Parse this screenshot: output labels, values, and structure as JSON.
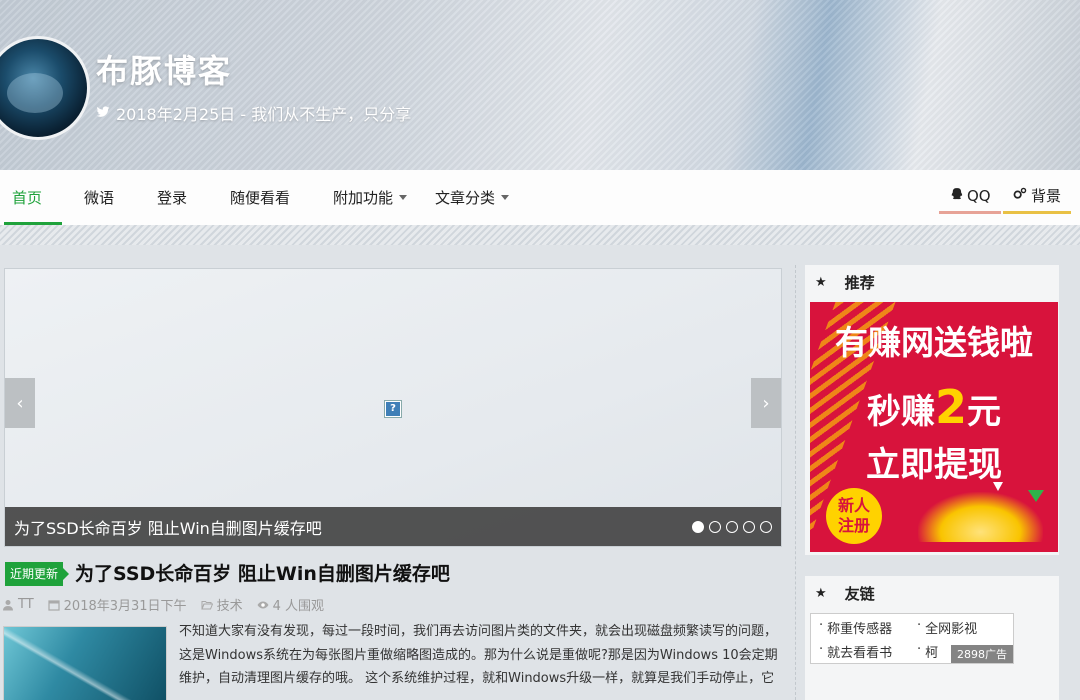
{
  "header": {
    "site_title": "布豚博客",
    "tagline": "2018年2月25日 - 我们从不生产，只分享",
    "tagline_icon": "twitter-icon"
  },
  "nav": {
    "items": [
      {
        "label": "首页",
        "active": true
      },
      {
        "label": "微语"
      },
      {
        "label": "登录"
      },
      {
        "label": "随便看看"
      },
      {
        "label": "附加功能",
        "dropdown": true
      },
      {
        "label": "文章分类",
        "dropdown": true
      }
    ],
    "right": [
      {
        "label": "QQ",
        "icon": "qq-icon",
        "underline": "#e7a397"
      },
      {
        "label": "背景",
        "icon": "gears-icon",
        "underline": "#e9c145"
      }
    ],
    "active_color": "#1fa23b"
  },
  "slider": {
    "caption": "为了SSD长命百岁 阻止Win自删图片缓存吧",
    "broken_image_icon": "?",
    "prev_arrow": "‹",
    "next_arrow": "›",
    "dot_count": 5,
    "active_dot": 1
  },
  "post": {
    "tag": "近期更新",
    "title": "为了SSD长命百岁 阻止Win自删图片缓存吧",
    "author": "TT",
    "date": "2018年3月31日下午",
    "category": "技术",
    "views": "4 人围观",
    "excerpt": "不知道大家有没有发现，每过一段时间，我们再去访问图片类的文件夹，就会出现磁盘频繁读写的问题，这是Windows系统在为每张图片重做缩略图造成的。那为什么说是重做呢?那是因为Windows 10会定期维护，自动清理图片缓存的哦。 这个系统维护过程，就和Windows升级一样，就算是我们手动停止，它"
  },
  "sidebar": {
    "recommend": {
      "title": "推荐",
      "ad": {
        "line1": "有赚网送钱啦",
        "line2_prefix": "秒赚",
        "line2_amount": "2",
        "line2_suffix": "元",
        "line3": "立即提现",
        "badge_line1": "新人",
        "badge_line2": "注册",
        "bg_color": "#d8133c",
        "accent_color": "#ffd200"
      }
    },
    "friends": {
      "title": "友链",
      "links": [
        {
          "label": "称重传感器"
        },
        {
          "label": "全网影视"
        },
        {
          "label": "就去看看书"
        },
        {
          "label": "柯"
        }
      ],
      "ad_label": "2898广告"
    }
  }
}
